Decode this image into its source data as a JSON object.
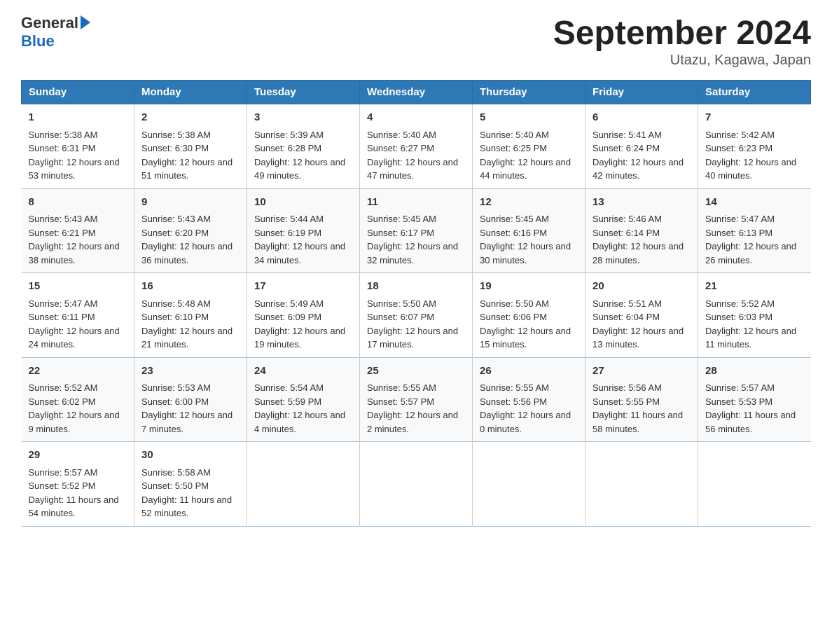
{
  "header": {
    "logo_general": "General",
    "logo_blue": "Blue",
    "title": "September 2024",
    "subtitle": "Utazu, Kagawa, Japan"
  },
  "weekdays": [
    "Sunday",
    "Monday",
    "Tuesday",
    "Wednesday",
    "Thursday",
    "Friday",
    "Saturday"
  ],
  "weeks": [
    [
      {
        "day": "1",
        "sunrise": "5:38 AM",
        "sunset": "6:31 PM",
        "daylight": "12 hours and 53 minutes."
      },
      {
        "day": "2",
        "sunrise": "5:38 AM",
        "sunset": "6:30 PM",
        "daylight": "12 hours and 51 minutes."
      },
      {
        "day": "3",
        "sunrise": "5:39 AM",
        "sunset": "6:28 PM",
        "daylight": "12 hours and 49 minutes."
      },
      {
        "day": "4",
        "sunrise": "5:40 AM",
        "sunset": "6:27 PM",
        "daylight": "12 hours and 47 minutes."
      },
      {
        "day": "5",
        "sunrise": "5:40 AM",
        "sunset": "6:25 PM",
        "daylight": "12 hours and 44 minutes."
      },
      {
        "day": "6",
        "sunrise": "5:41 AM",
        "sunset": "6:24 PM",
        "daylight": "12 hours and 42 minutes."
      },
      {
        "day": "7",
        "sunrise": "5:42 AM",
        "sunset": "6:23 PM",
        "daylight": "12 hours and 40 minutes."
      }
    ],
    [
      {
        "day": "8",
        "sunrise": "5:43 AM",
        "sunset": "6:21 PM",
        "daylight": "12 hours and 38 minutes."
      },
      {
        "day": "9",
        "sunrise": "5:43 AM",
        "sunset": "6:20 PM",
        "daylight": "12 hours and 36 minutes."
      },
      {
        "day": "10",
        "sunrise": "5:44 AM",
        "sunset": "6:19 PM",
        "daylight": "12 hours and 34 minutes."
      },
      {
        "day": "11",
        "sunrise": "5:45 AM",
        "sunset": "6:17 PM",
        "daylight": "12 hours and 32 minutes."
      },
      {
        "day": "12",
        "sunrise": "5:45 AM",
        "sunset": "6:16 PM",
        "daylight": "12 hours and 30 minutes."
      },
      {
        "day": "13",
        "sunrise": "5:46 AM",
        "sunset": "6:14 PM",
        "daylight": "12 hours and 28 minutes."
      },
      {
        "day": "14",
        "sunrise": "5:47 AM",
        "sunset": "6:13 PM",
        "daylight": "12 hours and 26 minutes."
      }
    ],
    [
      {
        "day": "15",
        "sunrise": "5:47 AM",
        "sunset": "6:11 PM",
        "daylight": "12 hours and 24 minutes."
      },
      {
        "day": "16",
        "sunrise": "5:48 AM",
        "sunset": "6:10 PM",
        "daylight": "12 hours and 21 minutes."
      },
      {
        "day": "17",
        "sunrise": "5:49 AM",
        "sunset": "6:09 PM",
        "daylight": "12 hours and 19 minutes."
      },
      {
        "day": "18",
        "sunrise": "5:50 AM",
        "sunset": "6:07 PM",
        "daylight": "12 hours and 17 minutes."
      },
      {
        "day": "19",
        "sunrise": "5:50 AM",
        "sunset": "6:06 PM",
        "daylight": "12 hours and 15 minutes."
      },
      {
        "day": "20",
        "sunrise": "5:51 AM",
        "sunset": "6:04 PM",
        "daylight": "12 hours and 13 minutes."
      },
      {
        "day": "21",
        "sunrise": "5:52 AM",
        "sunset": "6:03 PM",
        "daylight": "12 hours and 11 minutes."
      }
    ],
    [
      {
        "day": "22",
        "sunrise": "5:52 AM",
        "sunset": "6:02 PM",
        "daylight": "12 hours and 9 minutes."
      },
      {
        "day": "23",
        "sunrise": "5:53 AM",
        "sunset": "6:00 PM",
        "daylight": "12 hours and 7 minutes."
      },
      {
        "day": "24",
        "sunrise": "5:54 AM",
        "sunset": "5:59 PM",
        "daylight": "12 hours and 4 minutes."
      },
      {
        "day": "25",
        "sunrise": "5:55 AM",
        "sunset": "5:57 PM",
        "daylight": "12 hours and 2 minutes."
      },
      {
        "day": "26",
        "sunrise": "5:55 AM",
        "sunset": "5:56 PM",
        "daylight": "12 hours and 0 minutes."
      },
      {
        "day": "27",
        "sunrise": "5:56 AM",
        "sunset": "5:55 PM",
        "daylight": "11 hours and 58 minutes."
      },
      {
        "day": "28",
        "sunrise": "5:57 AM",
        "sunset": "5:53 PM",
        "daylight": "11 hours and 56 minutes."
      }
    ],
    [
      {
        "day": "29",
        "sunrise": "5:57 AM",
        "sunset": "5:52 PM",
        "daylight": "11 hours and 54 minutes."
      },
      {
        "day": "30",
        "sunrise": "5:58 AM",
        "sunset": "5:50 PM",
        "daylight": "11 hours and 52 minutes."
      },
      {
        "day": "",
        "sunrise": "",
        "sunset": "",
        "daylight": ""
      },
      {
        "day": "",
        "sunrise": "",
        "sunset": "",
        "daylight": ""
      },
      {
        "day": "",
        "sunrise": "",
        "sunset": "",
        "daylight": ""
      },
      {
        "day": "",
        "sunrise": "",
        "sunset": "",
        "daylight": ""
      },
      {
        "day": "",
        "sunrise": "",
        "sunset": "",
        "daylight": ""
      }
    ]
  ],
  "labels": {
    "sunrise": "Sunrise:",
    "sunset": "Sunset:",
    "daylight": "Daylight:"
  }
}
